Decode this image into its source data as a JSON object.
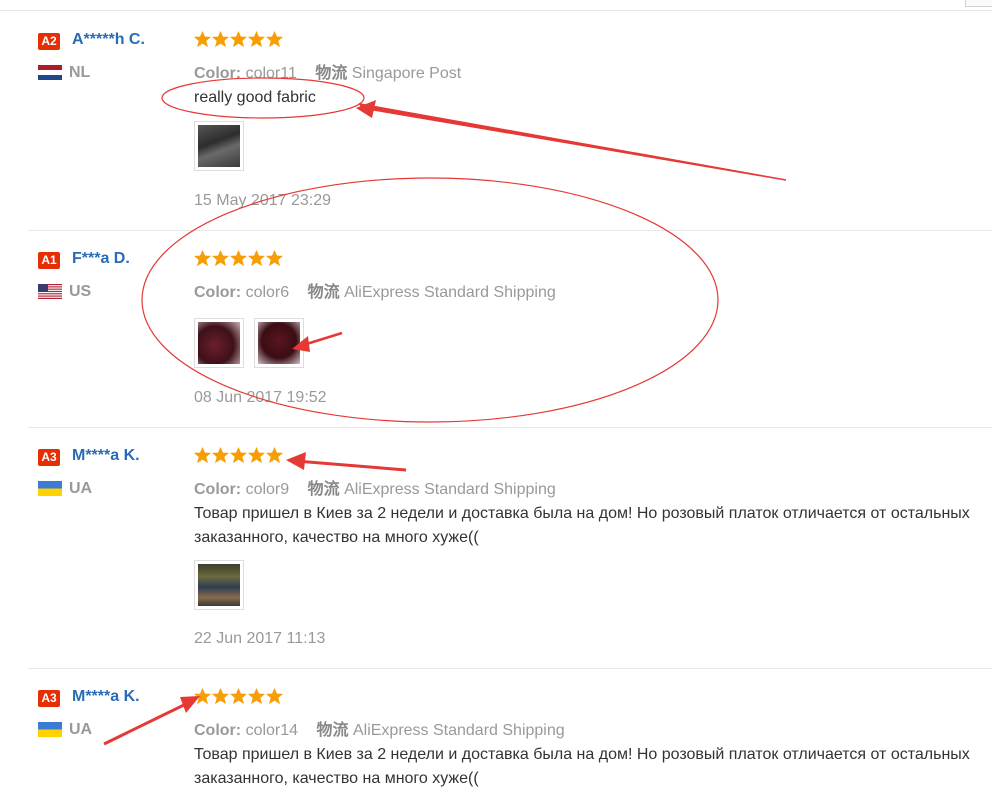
{
  "colors": {
    "badge": "#e62e04",
    "name": "#2a6bb7",
    "star": "#f79d06",
    "annotation": "#e53935"
  },
  "labels": {
    "color_label": "Color:",
    "shipping_label": "物流"
  },
  "reviews": [
    {
      "badge": "A2",
      "name": "A*****h C.",
      "flag_icon": "flag-netherlands-icon",
      "country": "NL",
      "rating": 5,
      "color": "color11",
      "shipping": "Singapore Post",
      "text": "really good fabric",
      "text_line2": "",
      "photos": 1,
      "date": "15 May 2017 23:29"
    },
    {
      "badge": "A1",
      "name": "F***a D.",
      "flag_icon": "flag-usa-icon",
      "country": "US",
      "rating": 5,
      "color": "color6",
      "shipping": "AliExpress Standard Shipping",
      "text": "",
      "text_line2": "",
      "photos": 2,
      "date": "08 Jun 2017 19:52"
    },
    {
      "badge": "A3",
      "name": "M****a K.",
      "flag_icon": "flag-ukraine-icon",
      "country": "UA",
      "rating": 5,
      "color": "color9",
      "shipping": "AliExpress Standard Shipping",
      "text": "Товар пришел в Киев за 2 недели и доставка была на дом! Но розовый платок отличается от остальных",
      "text_line2": "заказанного, качество на много хуже((",
      "photos": 1,
      "date": "22 Jun 2017 11:13"
    },
    {
      "badge": "A3",
      "name": "M****a K.",
      "flag_icon": "flag-ukraine-icon",
      "country": "UA",
      "rating": 5,
      "color": "color14",
      "shipping": "AliExpress Standard Shipping",
      "text": "Товар пришел в Киев за 2 недели и доставка была на дом! Но розовый платок отличается от остальных",
      "text_line2": "заказанного, качество на много хуже((",
      "photos": 0,
      "date": ""
    }
  ]
}
